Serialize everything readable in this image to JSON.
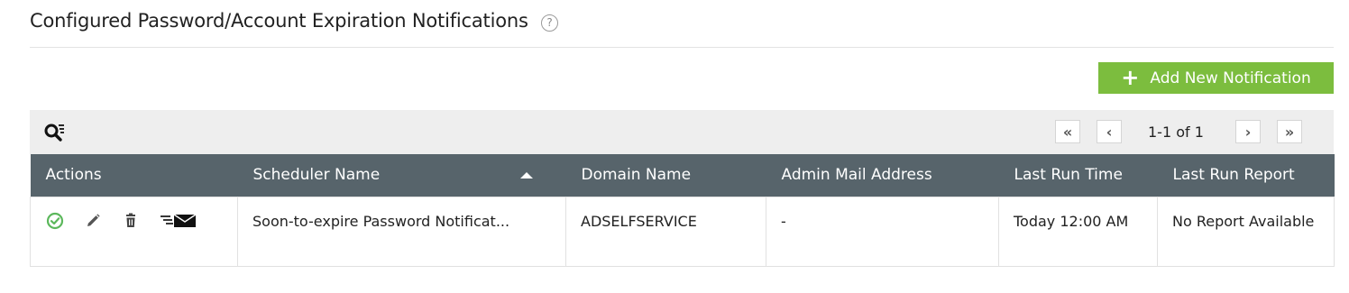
{
  "header": {
    "title": "Configured Password/Account Expiration Notifications",
    "help_glyph": "?"
  },
  "toolbar": {
    "add_button_label": "Add New Notification",
    "add_button_glyph": "+",
    "search_icon": "search-filter-icon"
  },
  "pagination": {
    "first_glyph": "«",
    "prev_glyph": "‹",
    "next_glyph": "›",
    "last_glyph": "»",
    "range_text": "1-1 of 1"
  },
  "table": {
    "columns": [
      {
        "label": "Actions"
      },
      {
        "label": "Scheduler Name",
        "sorted": "ascending"
      },
      {
        "label": "Domain Name"
      },
      {
        "label": "Admin Mail Address"
      },
      {
        "label": "Last Run Time"
      },
      {
        "label": "Last Run Report"
      }
    ],
    "rows": [
      {
        "actions": [
          "enable-status-icon",
          "edit-icon",
          "delete-icon",
          "send-mail-icon"
        ],
        "scheduler_name": "Soon-to-expire Password Notificat...",
        "domain_name": "ADSELFSERVICE",
        "admin_mail": "-",
        "last_run_time": "Today 12:00 AM",
        "last_run_report": "No Report Available"
      }
    ]
  },
  "colors": {
    "accent_green": "#7cbd3e",
    "header_bg": "#57646b",
    "toolbar_bg": "#eeeeee",
    "status_green": "#5cb85c"
  }
}
